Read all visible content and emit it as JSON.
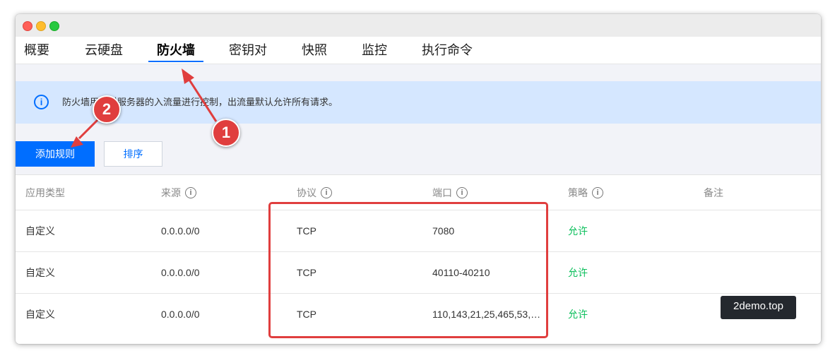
{
  "tabs": [
    {
      "label": "概要",
      "active": false
    },
    {
      "label": "云硬盘",
      "active": false
    },
    {
      "label": "防火墙",
      "active": true
    },
    {
      "label": "密钥对",
      "active": false
    },
    {
      "label": "快照",
      "active": false
    },
    {
      "label": "监控",
      "active": false
    },
    {
      "label": "执行命令",
      "active": false
    }
  ],
  "notice": {
    "icon": "info-icon",
    "text": "防火墙用于对服务器的入流量进行控制，出流量默认允许所有请求。"
  },
  "toolbar": {
    "add_rule": "添加规则",
    "sort": "排序"
  },
  "table": {
    "headers": [
      "应用类型",
      "来源",
      "协议",
      "端口",
      "策略",
      "备注"
    ],
    "rows": [
      {
        "type": "自定义",
        "source": "0.0.0.0/0",
        "protocol": "TCP",
        "port": "7080",
        "policy": "允许",
        "note": ""
      },
      {
        "type": "自定义",
        "source": "0.0.0.0/0",
        "protocol": "TCP",
        "port": "40110-40210",
        "policy": "允许",
        "note": ""
      },
      {
        "type": "自定义",
        "source": "0.0.0.0/0",
        "protocol": "TCP",
        "port": "110,143,21,25,465,53,…",
        "policy": "允许",
        "note": ""
      }
    ]
  },
  "annotations": {
    "badge1": "1",
    "badge2": "2"
  },
  "watermark": "2demo.top",
  "colors": {
    "accent": "#006eff",
    "allow": "#0abf5b",
    "annotation": "#e03e3e",
    "notice_bg": "#d5e7ff"
  }
}
